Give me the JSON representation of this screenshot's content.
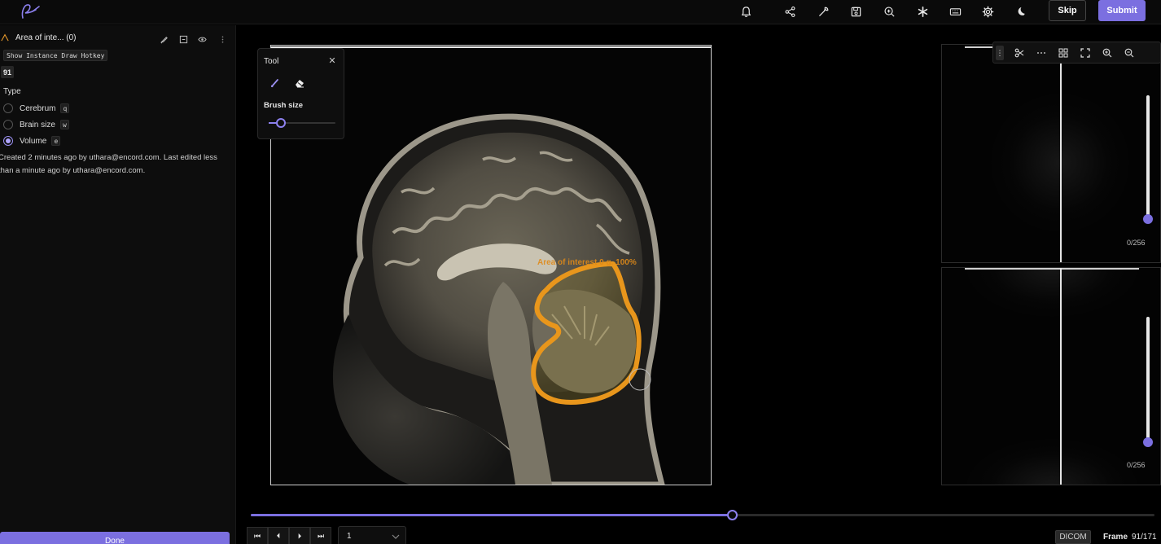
{
  "colors": {
    "accent": "#7b6fe0",
    "roi_outline": "#e8961c",
    "background": "#000000",
    "panel": "#0d0d0d"
  },
  "topbar": {
    "icons": [
      "bell-icon",
      "share-icon",
      "wrench-icon",
      "save-icon",
      "zoom-in-icon",
      "asterisk-icon",
      "keyboard-icon",
      "gear-icon",
      "moon-icon"
    ],
    "skip_label": "Skip",
    "submit_label": "Submit"
  },
  "sidebar": {
    "object_title": "Area of inte... (0)",
    "hotkey_chip": "Show Instance Draw Hotkey",
    "instance_number": "91",
    "type_label": "Type",
    "options": [
      {
        "label": "Cerebrum",
        "key": "q",
        "selected": false
      },
      {
        "label": "Brain size",
        "key": "w",
        "selected": false
      },
      {
        "label": "Volume",
        "key": "e",
        "selected": true
      }
    ],
    "meta_line1": "Created 2 minutes ago by uthara@encord.com. Last edited less",
    "meta_line2": "than a minute ago by uthara@encord.com.",
    "done_label": "Done"
  },
  "tool_panel": {
    "title": "Tool",
    "brush_size_label": "Brush size",
    "brush_size_fraction": 0.18
  },
  "viewer": {
    "roi_label": "Area of interest 0 g. 100%"
  },
  "side_views": {
    "top_count": "0/256",
    "bottom_count": "0/256",
    "top_slider_fraction": 0.0,
    "bottom_slider_fraction": 0.0
  },
  "playback": {
    "speed_value": "1",
    "dicom_label": "DICOM",
    "frame_label": "Frame",
    "frame_value": "91/171",
    "progress_fraction": 0.532
  }
}
